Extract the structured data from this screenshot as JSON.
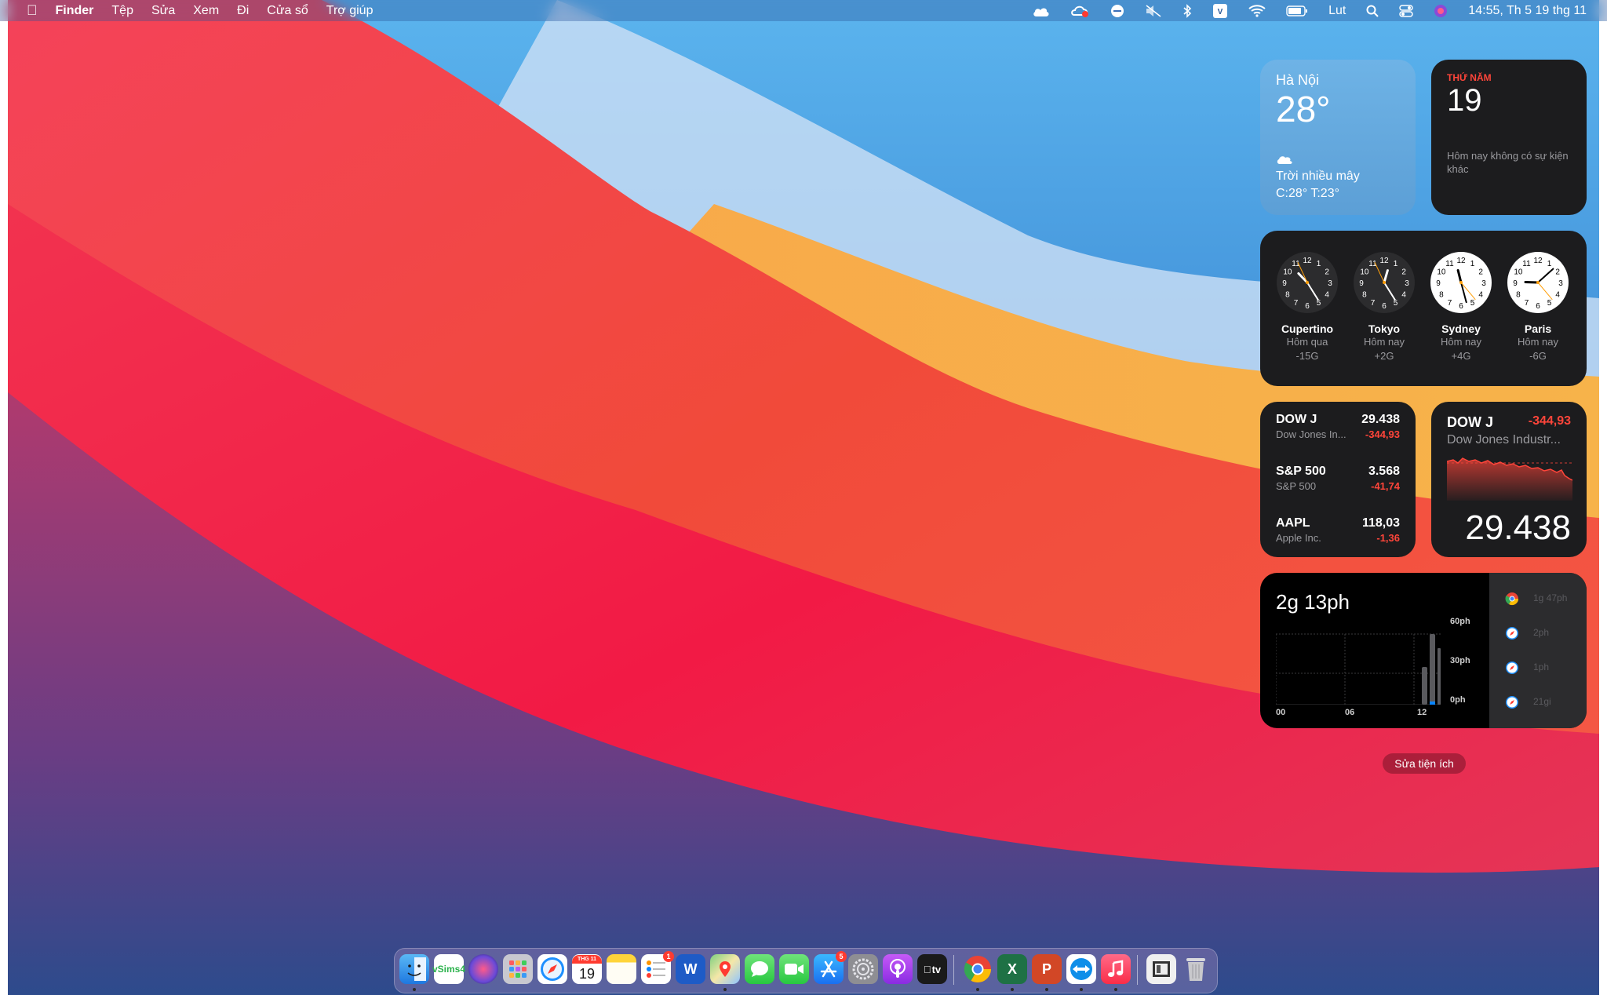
{
  "menubar": {
    "app_name": "Finder",
    "items": [
      "Tệp",
      "Sửa",
      "Xem",
      "Đi",
      "Cửa sổ",
      "Trợ giúp"
    ],
    "input_source": "Lut",
    "datetime": "14:55, Th 5 19 thg 11"
  },
  "weather": {
    "city": "Hà Nội",
    "temperature": "28°",
    "condition": "Trời nhiều mây",
    "high_low": "C:28° T:23°"
  },
  "calendar": {
    "weekday": "THỨ NĂM",
    "day": "19",
    "no_events": "Hôm nay không có sự kiện khác"
  },
  "world_clock": [
    {
      "city": "Cupertino",
      "day": "Hôm qua",
      "offset": "-15G",
      "face": "dark"
    },
    {
      "city": "Tokyo",
      "day": "Hôm nay",
      "offset": "+2G",
      "face": "dark"
    },
    {
      "city": "Sydney",
      "day": "Hôm nay",
      "offset": "+4G",
      "face": "light"
    },
    {
      "city": "Paris",
      "day": "Hôm nay",
      "offset": "-6G",
      "face": "light"
    }
  ],
  "stocks": [
    {
      "symbol": "DOW J",
      "name": "Dow Jones In...",
      "price": "29.438",
      "change": "-344,93"
    },
    {
      "symbol": "S&P 500",
      "name": "S&P 500",
      "price": "3.568",
      "change": "-41,74"
    },
    {
      "symbol": "AAPL",
      "name": "Apple Inc.",
      "price": "118,03",
      "change": "-1,36"
    }
  ],
  "stock_detail": {
    "symbol": "DOW J",
    "change": "-344,93",
    "name": "Dow Jones Industr...",
    "value": "29.438"
  },
  "screen_time": {
    "total": "2g 13ph",
    "y_labels": [
      "60ph",
      "30ph",
      "0ph"
    ],
    "x_labels": [
      "00",
      "06",
      "12"
    ],
    "apps": [
      {
        "icon": "chrome-icon",
        "time": "1g 47ph"
      },
      {
        "icon": "safari-icon",
        "time": "2ph"
      },
      {
        "icon": "safari-icon",
        "time": "1ph"
      },
      {
        "icon": "safari-icon",
        "time": "21gi"
      }
    ]
  },
  "edit_widgets_label": "Sửa tiện ích",
  "dock": {
    "calendar_month": "THG 11",
    "calendar_day": "19",
    "reminders_badge": "1",
    "appstore_badge": "5",
    "sims_label": "vSims4",
    "word_label": "W",
    "excel_label": "X",
    "ppt_label": "P",
    "tv_label": "tv"
  },
  "colors": {
    "negative": "#ff453a",
    "weather_bg": "#6eb3e6",
    "widget_dark": "#1c1c1e"
  }
}
